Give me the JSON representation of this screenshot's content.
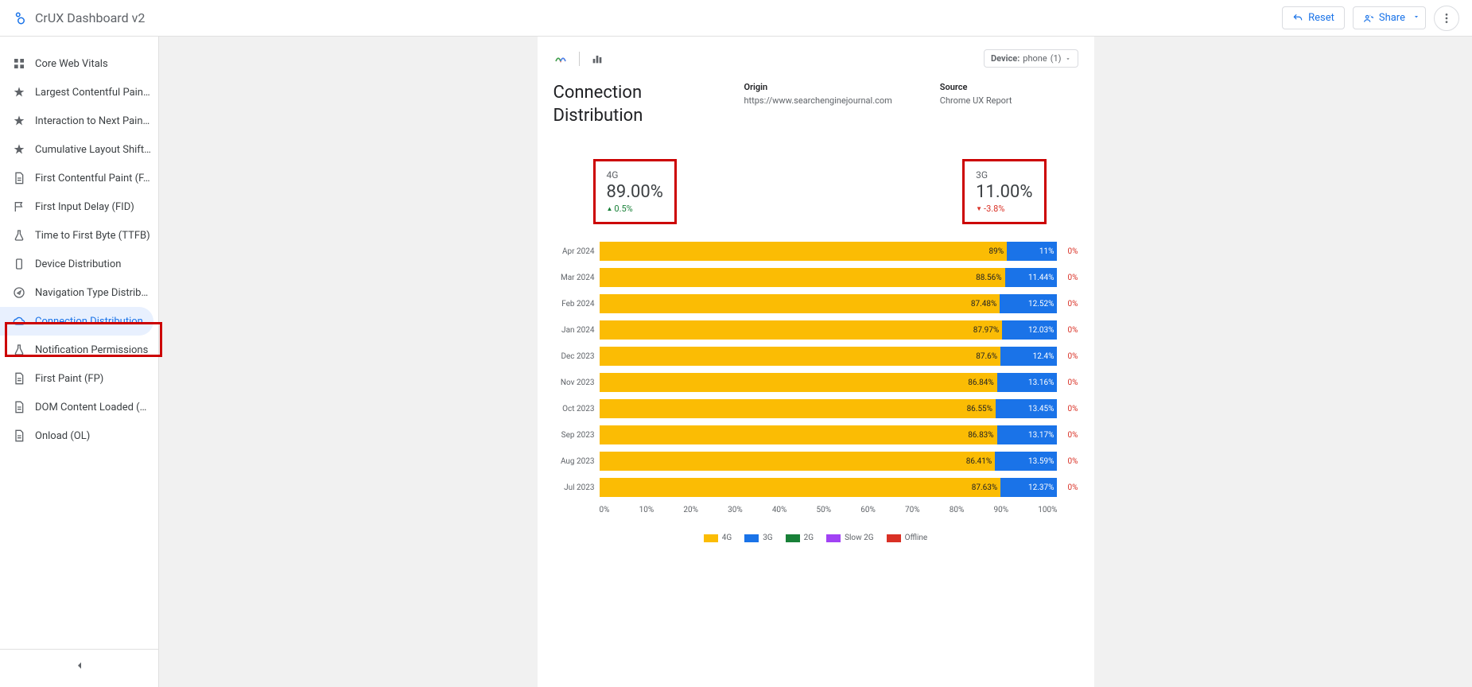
{
  "header": {
    "title": "CrUX Dashboard v2",
    "reset": "Reset",
    "share": "Share"
  },
  "sidebar": {
    "items": [
      {
        "label": "Core Web Vitals",
        "icon": "grid"
      },
      {
        "label": "Largest Contentful Pain…",
        "icon": "star"
      },
      {
        "label": "Interaction to Next Pain…",
        "icon": "star"
      },
      {
        "label": "Cumulative Layout Shift…",
        "icon": "star"
      },
      {
        "label": "First Contentful Paint (F…",
        "icon": "doc"
      },
      {
        "label": "First Input Delay (FID)",
        "icon": "flag"
      },
      {
        "label": "Time to First Byte (TTFB)",
        "icon": "flask"
      },
      {
        "label": "Device Distribution",
        "icon": "device"
      },
      {
        "label": "Navigation Type Distrib…",
        "icon": "compass"
      },
      {
        "label": "Connection Distribution",
        "icon": "cloud",
        "active": true
      },
      {
        "label": "Notification Permissions",
        "icon": "flask"
      },
      {
        "label": "First Paint (FP)",
        "icon": "doc"
      },
      {
        "label": "DOM Content Loaded (…",
        "icon": "doc"
      },
      {
        "label": "Onload (OL)",
        "icon": "doc"
      }
    ]
  },
  "report": {
    "title": "Connection Distribution",
    "device_label": "Device:",
    "device_value": "phone",
    "device_count": "(1)",
    "origin_label": "Origin",
    "origin_value": "https://www.searchenginejournal.com",
    "source_label": "Source",
    "source_value": "Chrome UX Report"
  },
  "scorecards": [
    {
      "label": "4G",
      "value": "89.00%",
      "delta": "0.5%",
      "dir": "up"
    },
    {
      "label": "3G",
      "value": "11.00%",
      "delta": "-3.8%",
      "dir": "down"
    }
  ],
  "legend": {
    "g4": "4G",
    "g3": "3G",
    "g2": "2G",
    "slow": "Slow 2G",
    "off": "Offline"
  },
  "axis": [
    "0%",
    "10%",
    "20%",
    "30%",
    "40%",
    "50%",
    "60%",
    "70%",
    "80%",
    "90%",
    "100%"
  ],
  "zero": "0%",
  "chart_data": {
    "type": "bar",
    "title": "Connection Distribution",
    "xlabel": "",
    "ylabel": "",
    "xlim": [
      0,
      100
    ],
    "categories": [
      "Apr 2024",
      "Mar 2024",
      "Feb 2024",
      "Jan 2024",
      "Dec 2023",
      "Nov 2023",
      "Oct 2023",
      "Sep 2023",
      "Aug 2023",
      "Jul 2023"
    ],
    "series": [
      {
        "name": "4G",
        "values": [
          89.0,
          88.56,
          87.48,
          87.97,
          87.6,
          86.84,
          86.55,
          86.83,
          86.41,
          87.63
        ],
        "labels": [
          "89%",
          "88.56%",
          "87.48%",
          "87.97%",
          "87.6%",
          "86.84%",
          "86.55%",
          "86.83%",
          "86.41%",
          "87.63%"
        ],
        "color": "#fbbc04"
      },
      {
        "name": "3G",
        "values": [
          11.0,
          11.44,
          12.52,
          12.03,
          12.4,
          13.16,
          13.45,
          13.17,
          13.59,
          12.37
        ],
        "labels": [
          "11%",
          "11.44%",
          "12.52%",
          "12.03%",
          "12.4%",
          "13.16%",
          "13.45%",
          "13.17%",
          "13.59%",
          "12.37%"
        ],
        "color": "#1a73e8"
      },
      {
        "name": "2G",
        "values": [
          0,
          0,
          0,
          0,
          0,
          0,
          0,
          0,
          0,
          0
        ],
        "color": "#188038"
      },
      {
        "name": "Slow 2G",
        "values": [
          0,
          0,
          0,
          0,
          0,
          0,
          0,
          0,
          0,
          0
        ],
        "color": "#a142f4"
      },
      {
        "name": "Offline",
        "values": [
          0,
          0,
          0,
          0,
          0,
          0,
          0,
          0,
          0,
          0
        ],
        "color": "#d93025"
      }
    ]
  }
}
